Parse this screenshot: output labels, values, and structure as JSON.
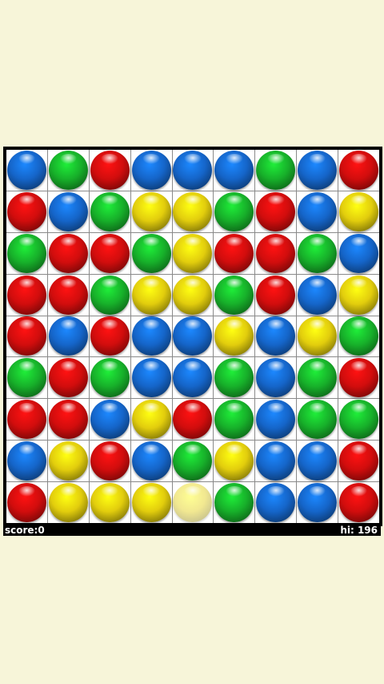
{
  "colors": {
    "blue": "#1565c9",
    "green": "#17b02a",
    "red": "#d10d0d",
    "yellow": "#e2cd0d"
  },
  "board": {
    "rows": [
      [
        "blue",
        "green",
        "red",
        "blue",
        "blue",
        "blue",
        "green",
        "blue",
        "red"
      ],
      [
        "red",
        "blue",
        "green",
        "yellow",
        "yellow",
        "green",
        "red",
        "blue",
        "yellow"
      ],
      [
        "green",
        "red",
        "red",
        "green",
        "yellow",
        "red",
        "red",
        "green",
        "blue"
      ],
      [
        "red",
        "red",
        "green",
        "yellow",
        "yellow",
        "green",
        "red",
        "blue",
        "yellow"
      ],
      [
        "red",
        "blue",
        "red",
        "blue",
        "blue",
        "yellow",
        "blue",
        "yellow",
        "green"
      ],
      [
        "green",
        "red",
        "green",
        "blue",
        "blue",
        "green",
        "blue",
        "green",
        "red"
      ],
      [
        "red",
        "red",
        "blue",
        "yellow",
        "red",
        "green",
        "blue",
        "green",
        "green"
      ],
      [
        "blue",
        "yellow",
        "red",
        "blue",
        "green",
        "yellow",
        "blue",
        "blue",
        "red"
      ],
      [
        "red",
        "yellow",
        "yellow",
        "yellow",
        "yellow-faded",
        "green",
        "blue",
        "blue",
        "red"
      ]
    ]
  },
  "status": {
    "score_text": "score:0",
    "hi_text": "hi: 196"
  }
}
